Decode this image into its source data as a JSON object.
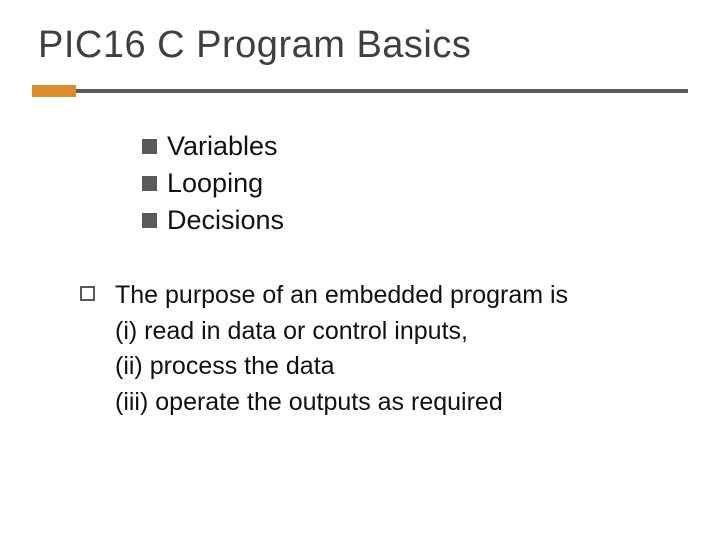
{
  "title": "PIC16 C Program Basics",
  "bullets": {
    "items": [
      {
        "label": "Variables"
      },
      {
        "label": "Looping"
      },
      {
        "label": "Decisions"
      }
    ]
  },
  "para": {
    "line1": "The purpose of an embedded program is",
    "line2": "(i) read in data or control inputs,",
    "line3": "(ii) process the data",
    "line4": "(iii) operate the outputs as required"
  }
}
